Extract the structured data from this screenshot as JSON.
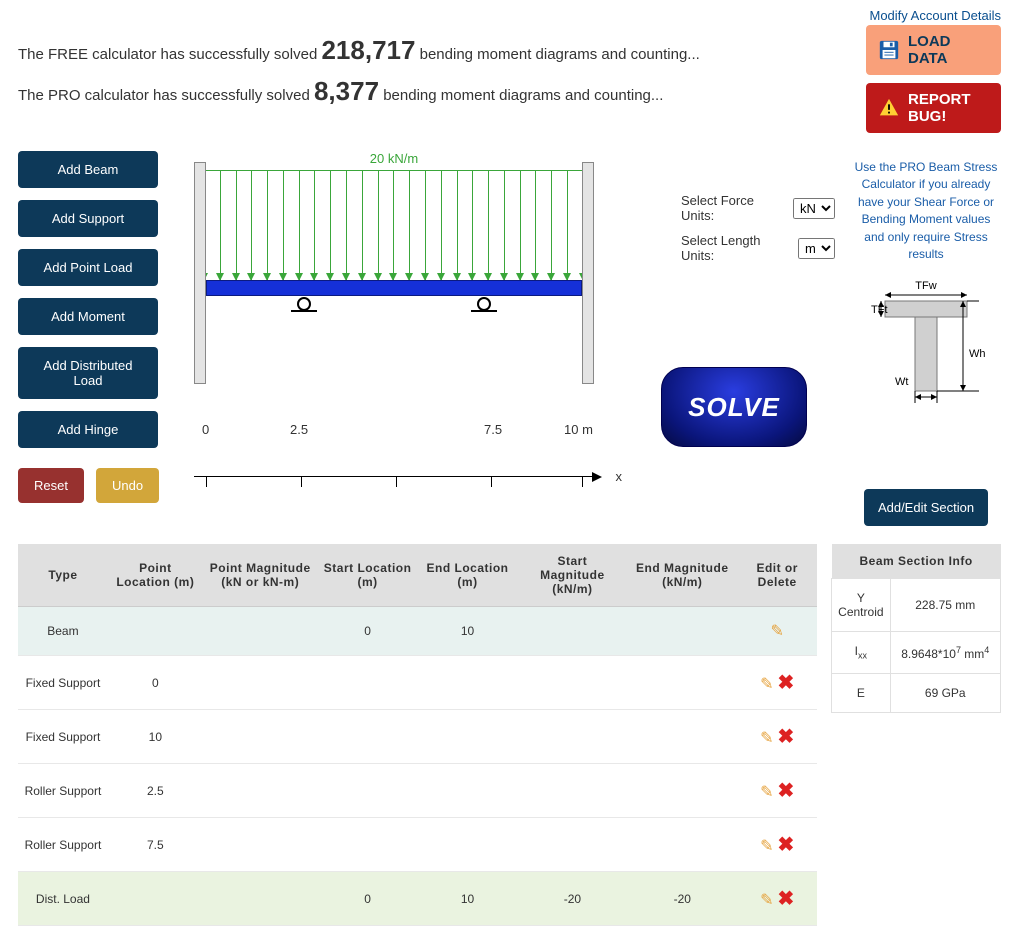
{
  "top_link": "Modify Account Details",
  "stats": {
    "free_pre": "The FREE calculator has successfully solved ",
    "free_count": "218,717",
    "free_post": " bending moment diagrams and counting...",
    "pro_pre": "The PRO calculator has successfully solved ",
    "pro_count": "8,377",
    "pro_post": " bending moment diagrams and counting..."
  },
  "left_buttons": {
    "add_beam": "Add Beam",
    "add_support": "Add Support",
    "add_point_load": "Add Point Load",
    "add_moment": "Add Moment",
    "add_dist_load": "Add Distributed Load",
    "add_hinge": "Add Hinge",
    "reset": "Reset",
    "undo": "Undo"
  },
  "right_buttons": {
    "load_data": "LOAD DATA",
    "report_bug": "REPORT BUG!",
    "add_edit_section": "Add/Edit Section"
  },
  "pro_note": "Use the PRO Beam Stress Calculator if you already have your Shear Force or Bending Moment values and only require Stress results",
  "section_labels": {
    "tfw": "TFw",
    "tft": "TFt",
    "wh": "Wh",
    "wt": "Wt"
  },
  "units": {
    "force_label": "Select Force Units:",
    "force_value": "kN",
    "length_label": "Select Length Units:",
    "length_value": "m"
  },
  "solve": "SOLVE",
  "diagram": {
    "load_label": "20 kN/m",
    "axis": {
      "t0": "0",
      "t1": "2.5",
      "t2": "7.5",
      "t3": "10 m",
      "x": "x"
    }
  },
  "table": {
    "headers": {
      "type": "Type",
      "point_loc": "Point Location (m)",
      "point_mag": "Point Magnitude (kN or kN-m)",
      "start_loc": "Start Location (m)",
      "end_loc": "End Location (m)",
      "start_mag": "Start Magnitude (kN/m)",
      "end_mag": "End Magnitude (kN/m)",
      "edit": "Edit or Delete"
    },
    "rows": [
      {
        "type": "Beam",
        "ploc": "",
        "pmag": "",
        "sloc": "0",
        "eloc": "10",
        "smag": "",
        "emag": "",
        "edit": true,
        "del": false
      },
      {
        "type": "Fixed Support",
        "ploc": "0",
        "pmag": "",
        "sloc": "",
        "eloc": "",
        "smag": "",
        "emag": "",
        "edit": true,
        "del": true
      },
      {
        "type": "Fixed Support",
        "ploc": "10",
        "pmag": "",
        "sloc": "",
        "eloc": "",
        "smag": "",
        "emag": "",
        "edit": true,
        "del": true
      },
      {
        "type": "Roller Support",
        "ploc": "2.5",
        "pmag": "",
        "sloc": "",
        "eloc": "",
        "smag": "",
        "emag": "",
        "edit": true,
        "del": true
      },
      {
        "type": "Roller Support",
        "ploc": "7.5",
        "pmag": "",
        "sloc": "",
        "eloc": "",
        "smag": "",
        "emag": "",
        "edit": true,
        "del": true
      },
      {
        "type": "Dist. Load",
        "ploc": "",
        "pmag": "",
        "sloc": "0",
        "eloc": "10",
        "smag": "-20",
        "emag": "-20",
        "edit": true,
        "del": true
      }
    ]
  },
  "section_info": {
    "title": "Beam Section Info",
    "rows": {
      "ycent_label": "Y Centroid",
      "ycent_val": "228.75 mm",
      "ixx_label": "I",
      "ixx_sub": "xx",
      "ixx_val_pre": "8.9648*10",
      "ixx_sup": "7",
      "ixx_unit": " mm",
      "ixx_unit_sup": "4",
      "e_label": "E",
      "e_val": "69 GPa"
    }
  }
}
